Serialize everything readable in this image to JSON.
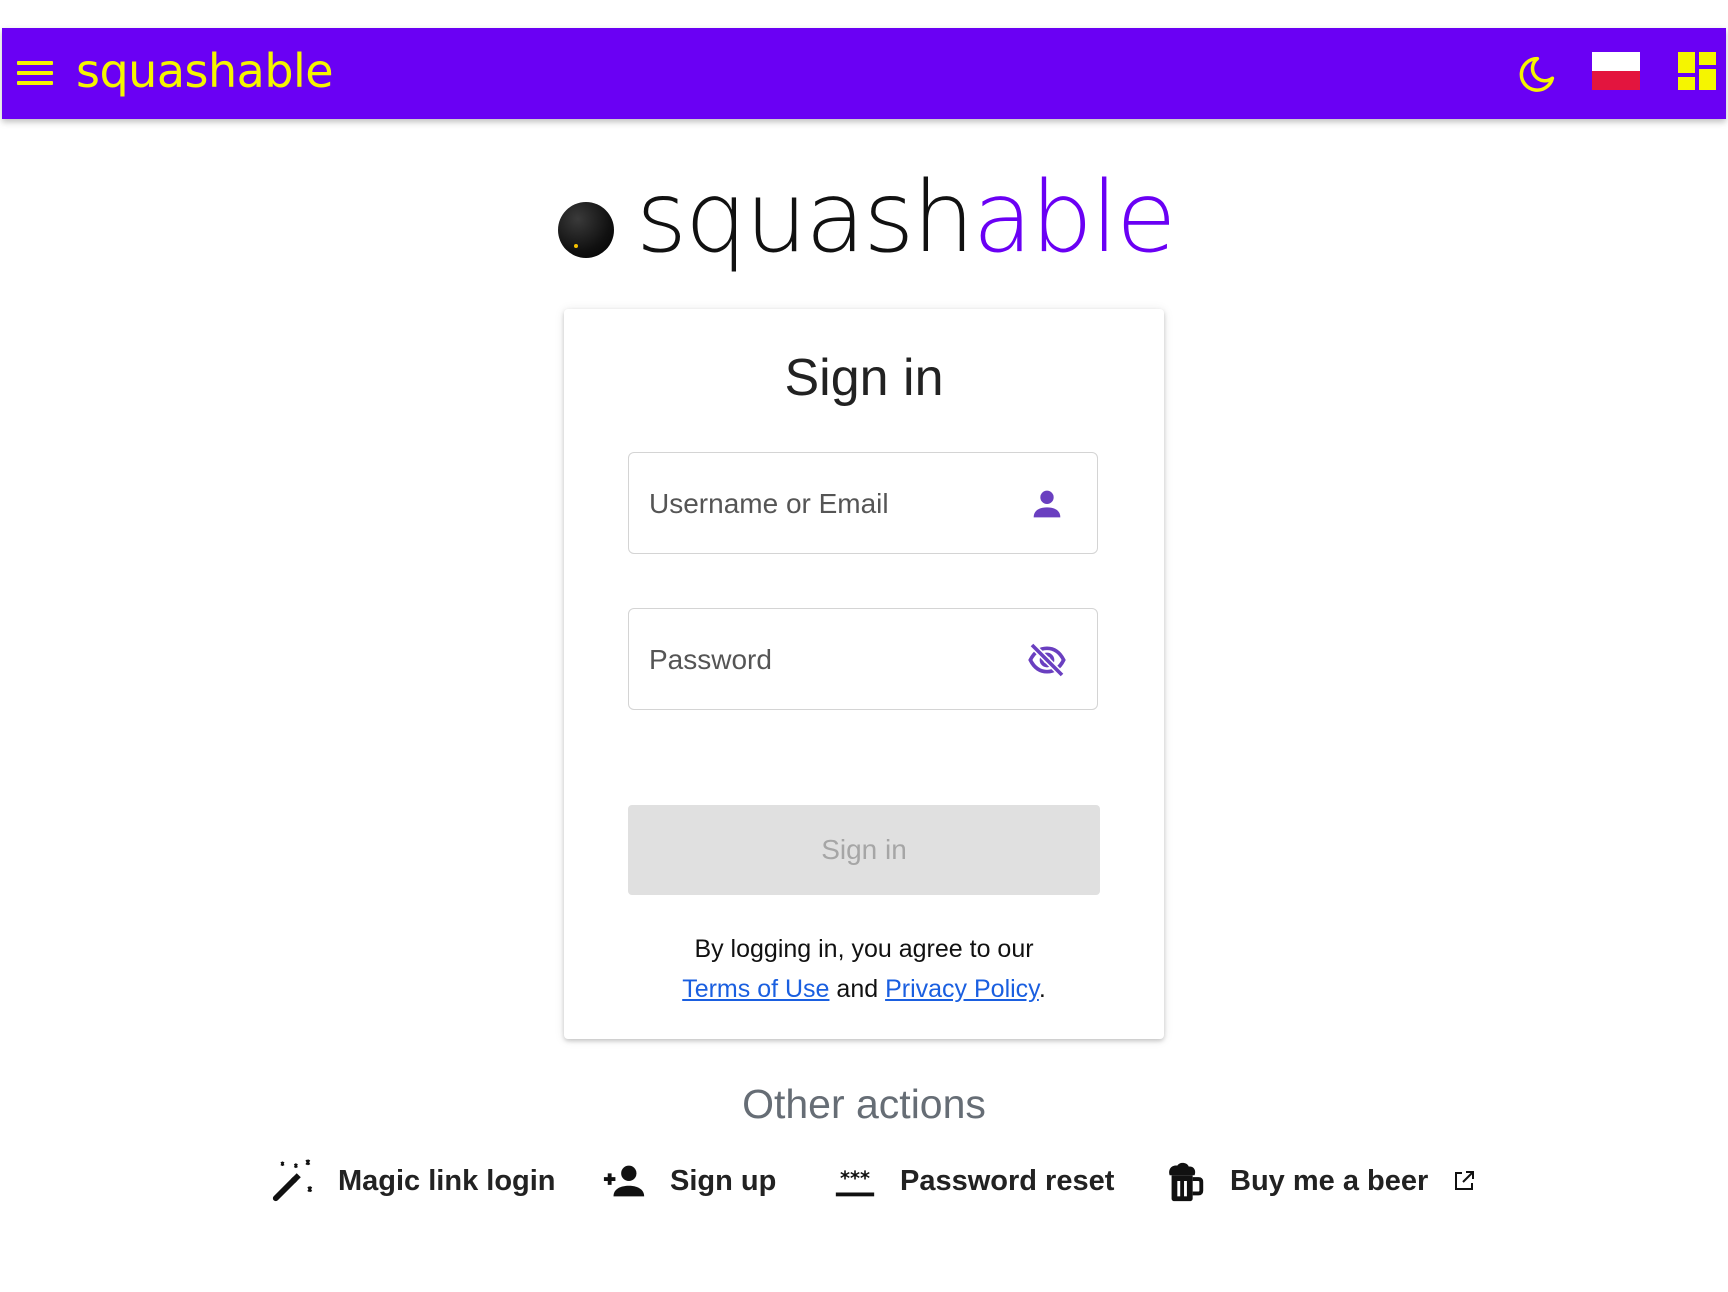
{
  "header": {
    "brand": "squashable",
    "menu_icon": "menu-icon",
    "theme_icon": "moon-icon",
    "language_icon": "poland-flag-icon",
    "dashboard_icon": "dashboard-icon",
    "background_color": "#6a00f4",
    "foreground_color": "#f5f500"
  },
  "logo": {
    "part1": "squash",
    "part2": "able",
    "ball_icon": "squash-ball-icon"
  },
  "login_card": {
    "title": "Sign in",
    "username_placeholder": "Username or Email",
    "username_icon": "person-icon",
    "password_placeholder": "Password",
    "password_icon": "eye-off-icon",
    "submit_label": "Sign in",
    "agree_text": "By logging in, you agree to our",
    "terms_label": "Terms of Use",
    "and_text": "and",
    "privacy_label": "Privacy Policy",
    "period": "."
  },
  "other_actions": {
    "title": "Other actions",
    "items": [
      {
        "label": "Magic link login",
        "icon": "magic-wand-icon"
      },
      {
        "label": "Sign up",
        "icon": "person-add-icon"
      },
      {
        "label": "Password reset",
        "icon": "password-icon"
      },
      {
        "label": "Buy me a beer",
        "icon": "beer-icon",
        "trailing_icon": "external-link-icon"
      }
    ]
  }
}
